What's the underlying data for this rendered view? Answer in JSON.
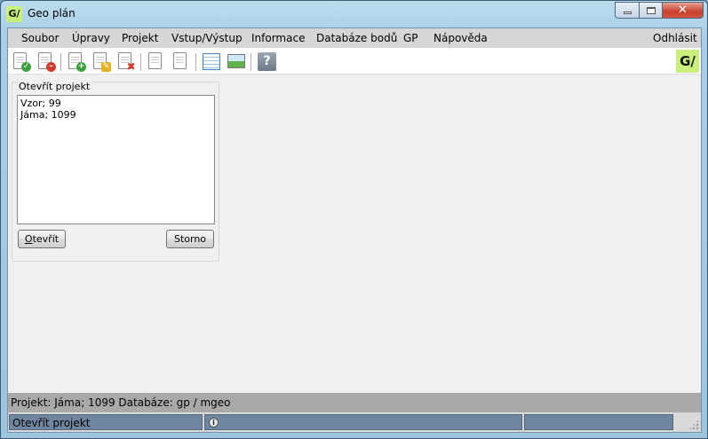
{
  "window": {
    "title": "Geo plán",
    "app_icon_text": "G/",
    "controls": {
      "minimize_icon": "minimize-icon",
      "maximize_icon": "maximize-icon",
      "close_icon": "close-icon"
    }
  },
  "menu": {
    "items": [
      "Soubor",
      "Úpravy",
      "Projekt",
      "Vstup/Výstup",
      "Informace",
      "Databáze bodů",
      "GP",
      "Nápověda"
    ],
    "logout": "Odhlásit"
  },
  "toolbar": {
    "buttons": [
      {
        "icon": "document-check-icon"
      },
      {
        "icon": "document-remove-icon"
      },
      {
        "icon": "document-add-icon"
      },
      {
        "icon": "document-edit-icon"
      },
      {
        "icon": "document-delete-icon"
      },
      {
        "icon": "document-list-icon"
      },
      {
        "icon": "document-text-icon"
      },
      {
        "icon": "table-icon"
      },
      {
        "icon": "image-icon"
      },
      {
        "icon": "help-icon",
        "glyph": "?"
      }
    ],
    "logo_text": "G/"
  },
  "open_project": {
    "legend": "Otevřít projekt",
    "projects": [
      "Vzor; 99",
      "Jáma; 1099"
    ],
    "open_button": "Otevřít",
    "open_button_accel": "O",
    "open_button_rest": "tevřít",
    "cancel_button": "Storno"
  },
  "status": {
    "text": "Projekt: Jáma; 1099  Databáze: gp / mgeo"
  },
  "bottom": {
    "panel_text": "Otevřít projekt",
    "info_glyph": "i"
  }
}
